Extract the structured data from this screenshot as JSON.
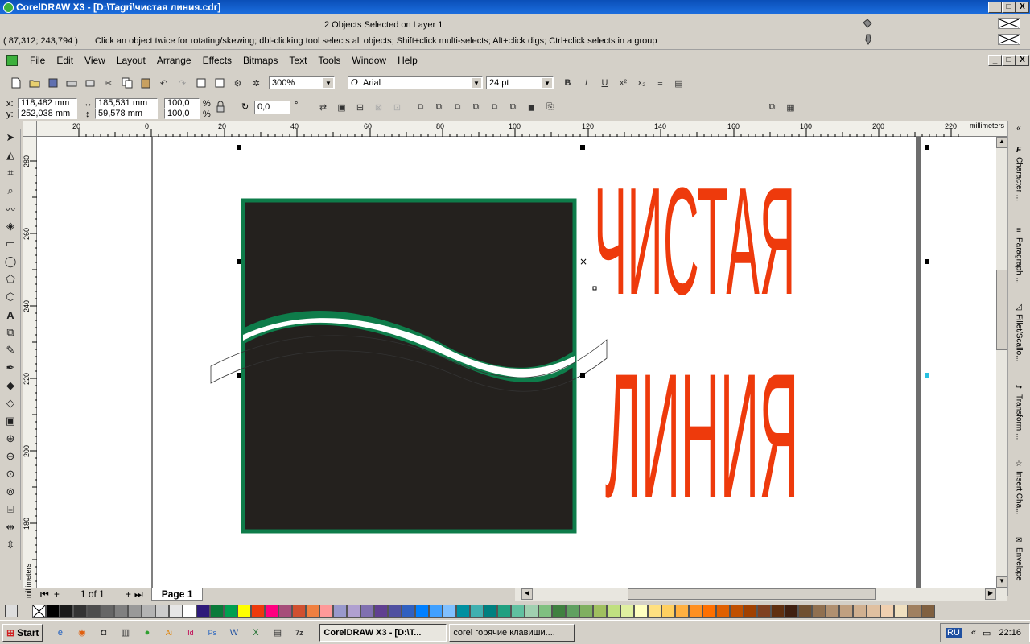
{
  "window": {
    "title": "CorelDRAW X3 - [D:\\Tagri\\чистая линия.cdr]",
    "min": "_",
    "max": "□",
    "close": "X"
  },
  "status": {
    "selection": "2 Objects Selected on Layer 1",
    "coords": "( 87,312; 243,794 )",
    "hint": "Click an object twice for rotating/skewing; dbl-clicking tool selects all objects; Shift+click multi-selects; Alt+click digs; Ctrl+click selects in a group"
  },
  "menu": [
    "File",
    "Edit",
    "View",
    "Layout",
    "Arrange",
    "Effects",
    "Bitmaps",
    "Text",
    "Tools",
    "Window",
    "Help"
  ],
  "standard": {
    "zoom": "300%",
    "font": "Arial",
    "size": "24 pt"
  },
  "property": {
    "x_label": "x:",
    "y_label": "y:",
    "x": "118,482 mm",
    "y": "252,038 mm",
    "w": "185,531 mm",
    "h": "59,578 mm",
    "sx": "100,0",
    "sy": "100,0",
    "pct": "%",
    "angle": "0,0",
    "deg": "°"
  },
  "ruler": {
    "unit": "millimeters",
    "h_ticks": [
      "20",
      "0",
      "20",
      "40",
      "60",
      "80",
      "100",
      "120",
      "140",
      "160",
      "180",
      "200",
      "220"
    ],
    "v_ticks": [
      "280",
      "260",
      "240",
      "220",
      "200",
      "180"
    ],
    "v_unit": "millimeters"
  },
  "artwork": {
    "line1": "ЧИСТАЯ",
    "line2": "ЛИНИЯ",
    "text_color": "#ee3a0c",
    "square_fill": "#24211e",
    "square_stroke": "#0e7c4a"
  },
  "dockers": [
    "Character ...",
    "Paragraph ...",
    "Fillet/Scallo...",
    "Transform ...",
    "Insert Cha...",
    "Envelope"
  ],
  "pagenav": {
    "count": "1 of 1",
    "tab": "Page 1"
  },
  "palette": [
    "#000000",
    "#1a1a1a",
    "#333333",
    "#4d4d4d",
    "#666666",
    "#808080",
    "#999999",
    "#b3b3b3",
    "#cccccc",
    "#e6e6e6",
    "#ffffff",
    "#2e1a7a",
    "#0a7a3a",
    "#00a050",
    "#ffff00",
    "#ee3a0c",
    "#ff0080",
    "#a64d79",
    "#d05030",
    "#f08040",
    "#ff9999",
    "#9999cc",
    "#b0a0d0",
    "#8070b0",
    "#604090",
    "#5050a0",
    "#3060c0",
    "#0080ff",
    "#40a0ff",
    "#80c0ff",
    "#0090a0",
    "#40b0b0",
    "#008080",
    "#20a080",
    "#60c0a0",
    "#a0d0b0",
    "#80c080",
    "#408040",
    "#60a060",
    "#80b060",
    "#a0c060",
    "#c0e080",
    "#e0f0a0",
    "#ffffc0",
    "#ffe080",
    "#ffd060",
    "#ffb040",
    "#ff9020",
    "#ff7000",
    "#e06000",
    "#c05000",
    "#a04000",
    "#804020",
    "#603010",
    "#402010",
    "#705030",
    "#907050",
    "#b09070",
    "#c0a080",
    "#d0b090",
    "#e0c0a0",
    "#f0d0b0",
    "#f0e0c0",
    "#a08060",
    "#806040"
  ],
  "taskbar": {
    "start": "Start",
    "items": [
      "CorelDRAW X3 - [D:\\T...",
      "corel горячие клавиши...."
    ],
    "lang": "RU",
    "time": "22:16"
  }
}
